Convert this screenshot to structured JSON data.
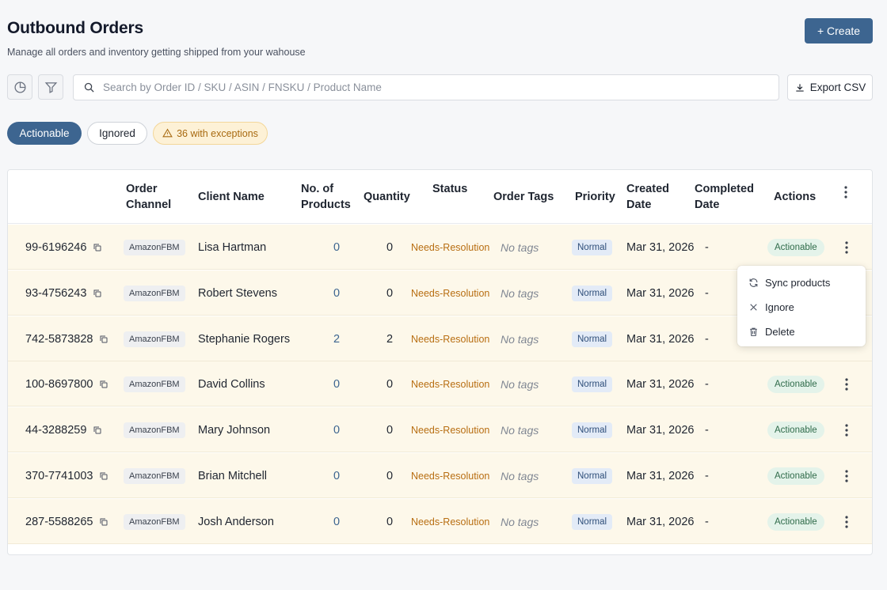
{
  "header": {
    "title": "Outbound Orders",
    "subtitle": "Manage all orders and inventory getting shipped from your wahouse",
    "create_label": "+ Create"
  },
  "toolbar": {
    "search_placeholder": "Search by Order ID / SKU / ASIN / FNSKU / Product Name",
    "search_value": "",
    "export_label": "Export CSV"
  },
  "filters": {
    "actionable_label": "Actionable",
    "ignored_label": "Ignored",
    "exceptions_label": "36 with exceptions"
  },
  "table": {
    "columns": [
      {
        "key": "order_id",
        "label": ""
      },
      {
        "key": "channel",
        "label": "Order Channel"
      },
      {
        "key": "client",
        "label": "Client Name"
      },
      {
        "key": "products",
        "label": "No. of Products"
      },
      {
        "key": "quantity",
        "label": "Quantity"
      },
      {
        "key": "status",
        "label": "Status"
      },
      {
        "key": "tags",
        "label": "Order Tags"
      },
      {
        "key": "priority",
        "label": "Priority"
      },
      {
        "key": "created",
        "label": "Created Date"
      },
      {
        "key": "completed",
        "label": "Completed Date"
      },
      {
        "key": "actions",
        "label": "Actions"
      }
    ],
    "rows": [
      {
        "order_id": "99-6196246",
        "channel": "AmazonFBM",
        "client": "Lisa Hartman",
        "products": "0",
        "quantity": "0",
        "status": "Needs-Resolution",
        "tags": "No tags",
        "priority": "Normal",
        "created": "Mar 31, 2026",
        "completed": "-",
        "action": "Actionable"
      },
      {
        "order_id": "93-4756243",
        "channel": "AmazonFBM",
        "client": "Robert Stevens",
        "products": "0",
        "quantity": "0",
        "status": "Needs-Resolution",
        "tags": "No tags",
        "priority": "Normal",
        "created": "Mar 31, 2026",
        "completed": "-",
        "action": ""
      },
      {
        "order_id": "742-5873828",
        "channel": "AmazonFBM",
        "client": "Stephanie Rogers",
        "products": "2",
        "quantity": "2",
        "status": "Needs-Resolution",
        "tags": "No tags",
        "priority": "Normal",
        "created": "Mar 31, 2026",
        "completed": "-",
        "action": ""
      },
      {
        "order_id": "100-8697800",
        "channel": "AmazonFBM",
        "client": "David Collins",
        "products": "0",
        "quantity": "0",
        "status": "Needs-Resolution",
        "tags": "No tags",
        "priority": "Normal",
        "created": "Mar 31, 2026",
        "completed": "-",
        "action": "Actionable"
      },
      {
        "order_id": "44-3288259",
        "channel": "AmazonFBM",
        "client": "Mary Johnson",
        "products": "0",
        "quantity": "0",
        "status": "Needs-Resolution",
        "tags": "No tags",
        "priority": "Normal",
        "created": "Mar 31, 2026",
        "completed": "-",
        "action": "Actionable"
      },
      {
        "order_id": "370-7741003",
        "channel": "AmazonFBM",
        "client": "Brian Mitchell",
        "products": "0",
        "quantity": "0",
        "status": "Needs-Resolution",
        "tags": "No tags",
        "priority": "Normal",
        "created": "Mar 31, 2026",
        "completed": "-",
        "action": "Actionable"
      },
      {
        "order_id": "287-5588265",
        "channel": "AmazonFBM",
        "client": "Josh Anderson",
        "products": "0",
        "quantity": "0",
        "status": "Needs-Resolution",
        "tags": "No tags",
        "priority": "Normal",
        "created": "Mar 31, 2026",
        "completed": "-",
        "action": "Actionable"
      }
    ]
  },
  "context_menu": {
    "items": [
      {
        "label": "Sync products",
        "icon": "refresh-icon"
      },
      {
        "label": "Ignore",
        "icon": "close-icon"
      },
      {
        "label": "Delete",
        "icon": "trash-icon"
      }
    ]
  },
  "colors": {
    "primary": "#3d6590",
    "row_highlight": "#fdf8ea",
    "status": "#b86e12",
    "exceptions_bg": "#fdf1d6"
  }
}
